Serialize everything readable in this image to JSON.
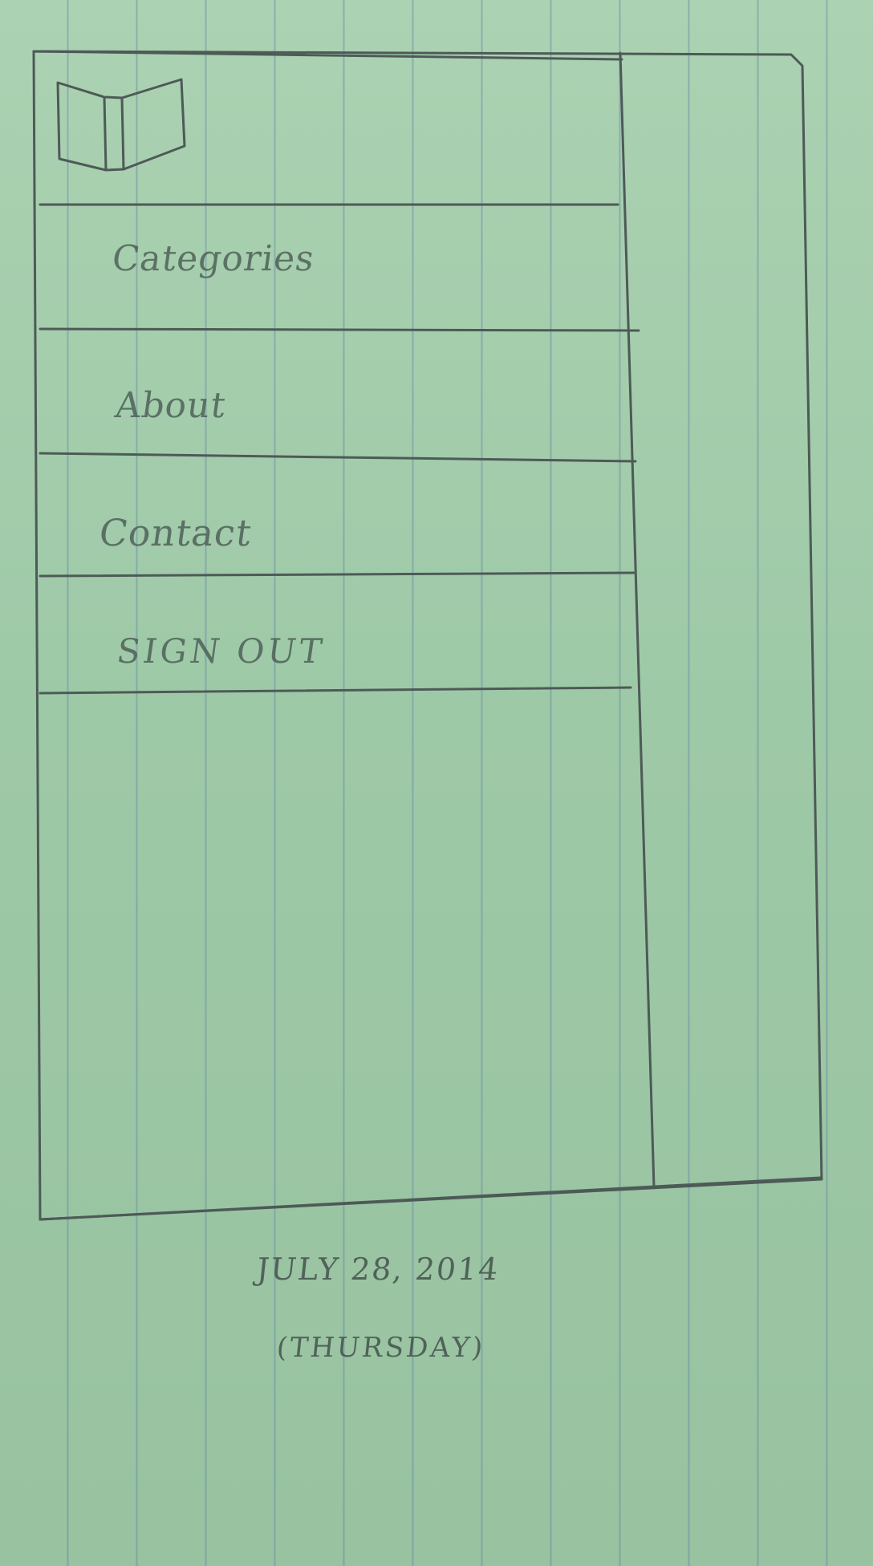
{
  "menu": {
    "items": [
      {
        "label": "Categories"
      },
      {
        "label": "About"
      },
      {
        "label": "Contact"
      },
      {
        "label": "SIGN OUT"
      }
    ]
  },
  "notes": {
    "date": "JULY 28, 2014",
    "weekday": "(THURSDAY)"
  },
  "colors": {
    "paper": "#9ec9a7",
    "grid_line": "#6d86b0",
    "pencil": "#4c5d56"
  },
  "icons": {
    "logo": "book-icon"
  }
}
